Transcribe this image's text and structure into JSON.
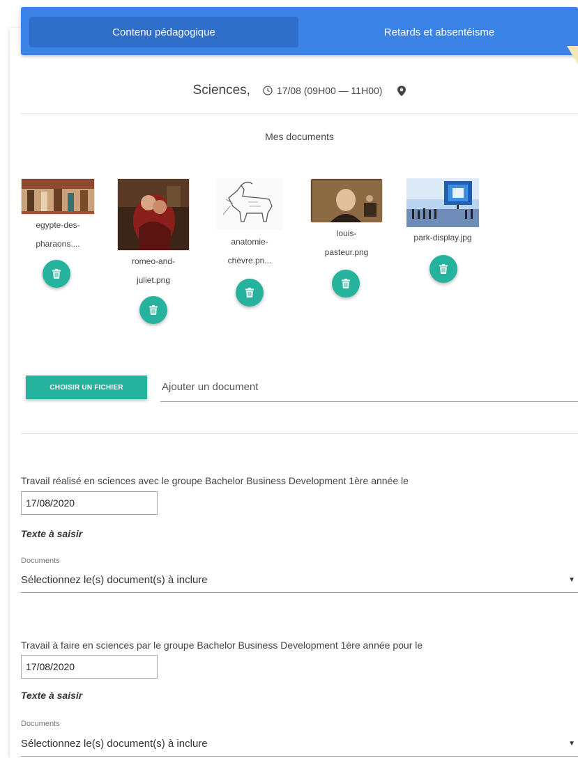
{
  "tabs": [
    {
      "label": "Contenu pédagogique",
      "active": true
    },
    {
      "label": "Retards et absentéisme",
      "active": false
    }
  ],
  "header": {
    "subject": "Sciences,",
    "date_time": "17/08 (09H00 — 11H00)",
    "clock_icon": "clock-icon",
    "location_icon": "location-pin-icon"
  },
  "documents": {
    "title": "Mes documents",
    "items": [
      {
        "name_line1": "egypte-des-",
        "name_line2": "pharaons...."
      },
      {
        "name_line1": "romeo-and-",
        "name_line2": "juliet.png"
      },
      {
        "name_line1": "anatomie-",
        "name_line2": "chèvre.pn..."
      },
      {
        "name_line1": "louis-",
        "name_line2": "pasteur.png"
      },
      {
        "name_line1": "park-display.jpg",
        "name_line2": ""
      }
    ],
    "delete_icon": "trash-icon"
  },
  "upload": {
    "button_label": "CHOISIR UN FICHIER",
    "placeholder": "Ajouter un document"
  },
  "work_done": {
    "label": "Travail réalisé en sciences avec le groupe Bachelor Business Development 1ère année le",
    "date": "17/08/2020",
    "text_label": "Texte à saisir",
    "documents_label": "Documents",
    "select_placeholder": "Sélectionnez le(s) document(s) à inclure"
  },
  "work_todo": {
    "label": "Travail à faire en sciences par le groupe Bachelor Business Development 1ère année pour le",
    "date": "17/08/2020",
    "text_label": "Texte à saisir",
    "documents_label": "Documents",
    "select_placeholder": "Sélectionnez le(s) document(s) à inclure"
  },
  "colors": {
    "tab_bar": "#3b82e6",
    "tab_active": "#2f6ec9",
    "accent": "#26b39e"
  }
}
